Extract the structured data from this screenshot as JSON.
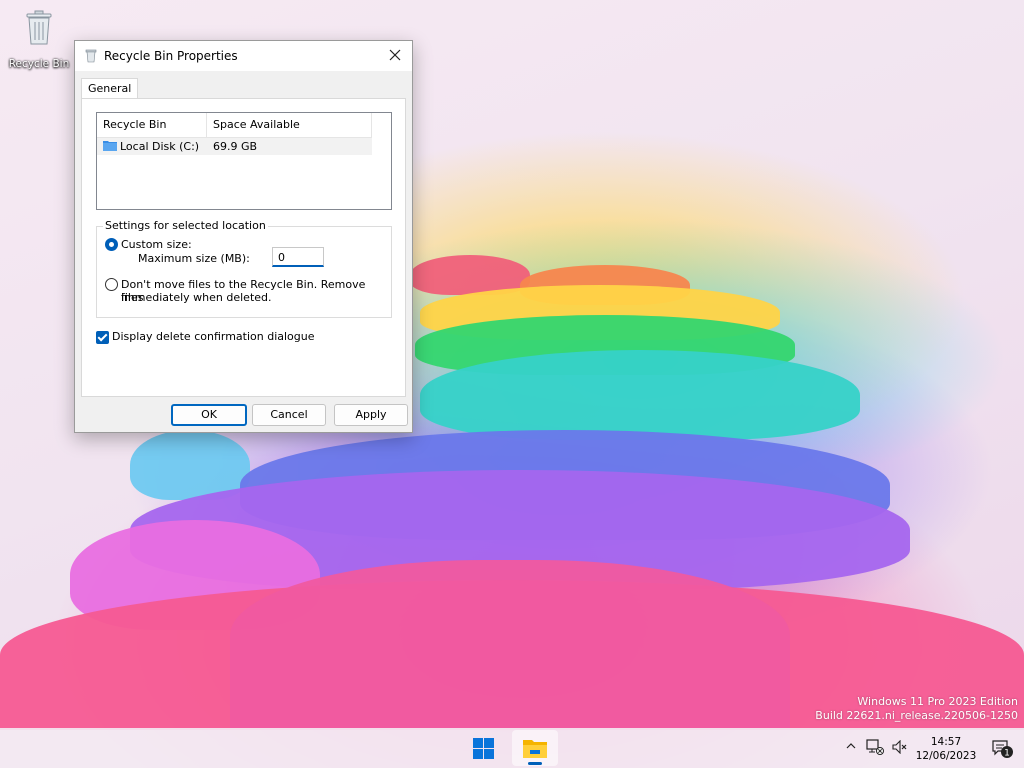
{
  "desktop": {
    "recycle_bin_label": "Recycle Bin"
  },
  "dialog": {
    "title": "Recycle Bin Properties",
    "tab": "General",
    "list": {
      "columns": [
        "Recycle Bin Location",
        "Space Available"
      ],
      "rows": [
        {
          "location": "Local Disk (C:)",
          "space": "69.9 GB"
        }
      ]
    },
    "settings": {
      "legend": "Settings for selected location",
      "custom_size_label": "Custom size:",
      "custom_size_selected": true,
      "max_size_label": "Maximum size (MB):",
      "max_size_value": "0",
      "dont_move_label_line1": "Don't move files to the Recycle Bin. Remove files",
      "dont_move_label_line2": "immediately when deleted.",
      "dont_move_selected": false
    },
    "confirm_label": "Display delete confirmation dialogue",
    "confirm_checked": true,
    "buttons": {
      "ok": "OK",
      "cancel": "Cancel",
      "apply": "Apply"
    }
  },
  "watermark": {
    "line1": "Windows 11 Pro 2023 Edition",
    "line2": "Build 22621.ni_release.220506-1250"
  },
  "taskbar": {
    "time": "14:57",
    "date": "12/06/2023",
    "notification_count": "1"
  },
  "colors": {
    "accent": "#005fb8"
  }
}
